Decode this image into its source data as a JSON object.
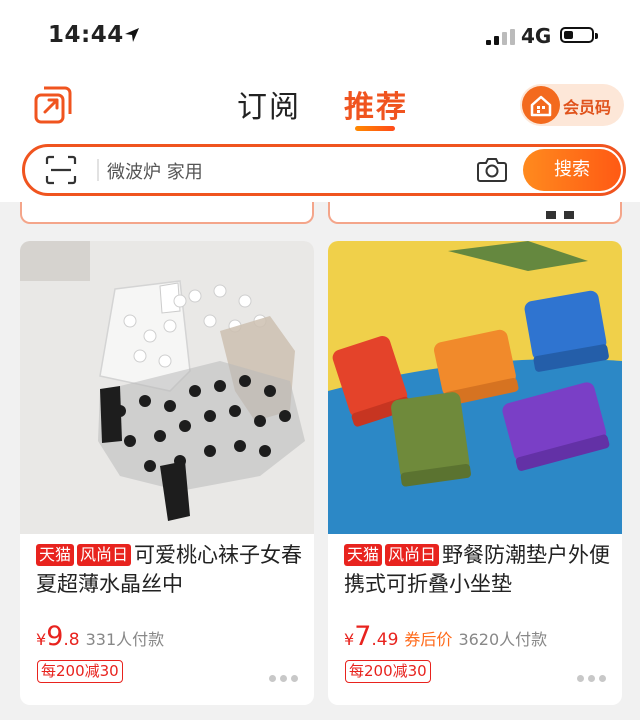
{
  "status_bar": {
    "time": "14:44",
    "network": "4G"
  },
  "header": {
    "tabs": [
      {
        "label": "订阅",
        "active": false
      },
      {
        "label": "推荐",
        "active": true
      }
    ],
    "member_code_label": "会员码",
    "accent_color": "#f0541f"
  },
  "search": {
    "placeholder": "微波炉 家用",
    "button_label": "搜索"
  },
  "products": [
    {
      "badges": [
        "天猫",
        "风尚日"
      ],
      "title": "可爱桃心袜子女春夏超薄水晶丝中",
      "currency": "¥",
      "price_int": "9",
      "price_dec": ".8",
      "coupon_label": "",
      "sold": "331人付款",
      "promo": "每200减30",
      "image_icon": "heart-pattern-socks-photo"
    },
    {
      "badges": [
        "天猫",
        "风尚日"
      ],
      "title": "野餐防潮垫户外便携式可折叠小坐垫",
      "currency": "¥",
      "price_int": "7",
      "price_dec": ".49",
      "coupon_label": "券后价",
      "sold": "3620人付款",
      "promo": "每200减30",
      "image_icon": "foldable-seat-pads-photo"
    }
  ]
}
